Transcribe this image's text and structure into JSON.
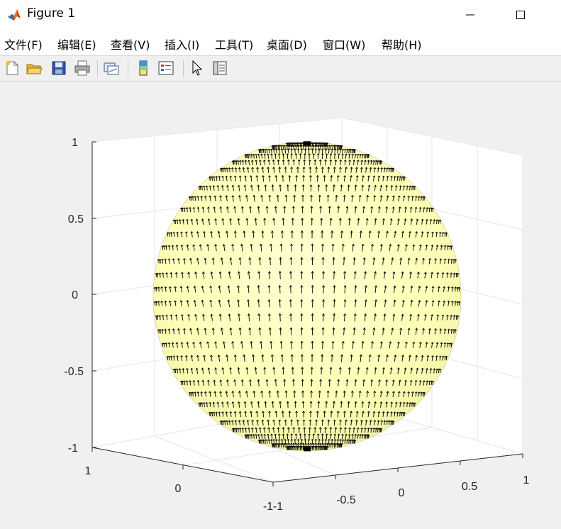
{
  "window": {
    "title": "Figure 1",
    "minimize_glyph": "—",
    "maximize_glyph": "☐"
  },
  "menu": {
    "items": [
      {
        "label": "文件(F)"
      },
      {
        "label": "编辑(E)"
      },
      {
        "label": "查看(V)"
      },
      {
        "label": "插入(I)"
      },
      {
        "label": "工具(T)"
      },
      {
        "label": "桌面(D)"
      },
      {
        "label": "窗口(W)"
      },
      {
        "label": "帮助(H)"
      }
    ]
  },
  "toolbar": {
    "buttons": [
      {
        "icon": "new-figure-icon"
      },
      {
        "icon": "open-file-icon"
      },
      {
        "icon": "save-icon"
      },
      {
        "icon": "print-icon"
      },
      {
        "icon": "link-plot-icon"
      },
      {
        "icon": "insert-colorbar-icon"
      },
      {
        "icon": "insert-legend-icon"
      },
      {
        "icon": "edit-plot-icon"
      },
      {
        "icon": "property-inspector-icon"
      }
    ]
  },
  "chart_data": {
    "type": "3d-surface-quiver",
    "description_of_marks": "unit sphere surface with tangent vector field arrows",
    "surface_color": "#ffffc0",
    "arrow_color": "#000000",
    "z_ticks": [
      "1",
      "0.5",
      "0",
      "-0.5",
      "-1"
    ],
    "x_ticks": [
      "-1",
      "-0.5",
      "0",
      "0.5",
      "1"
    ],
    "y_ticks": [
      "1",
      "0",
      "-1"
    ],
    "xlim": [
      -1,
      1
    ],
    "ylim": [
      -1,
      1
    ],
    "zlim": [
      -1,
      1
    ],
    "grid": true
  },
  "colors": {
    "figure_bg": "#f0f0f0",
    "axes_bg": "#ffffff",
    "grid": "#e6e6e6",
    "axis_line": "#262626"
  }
}
